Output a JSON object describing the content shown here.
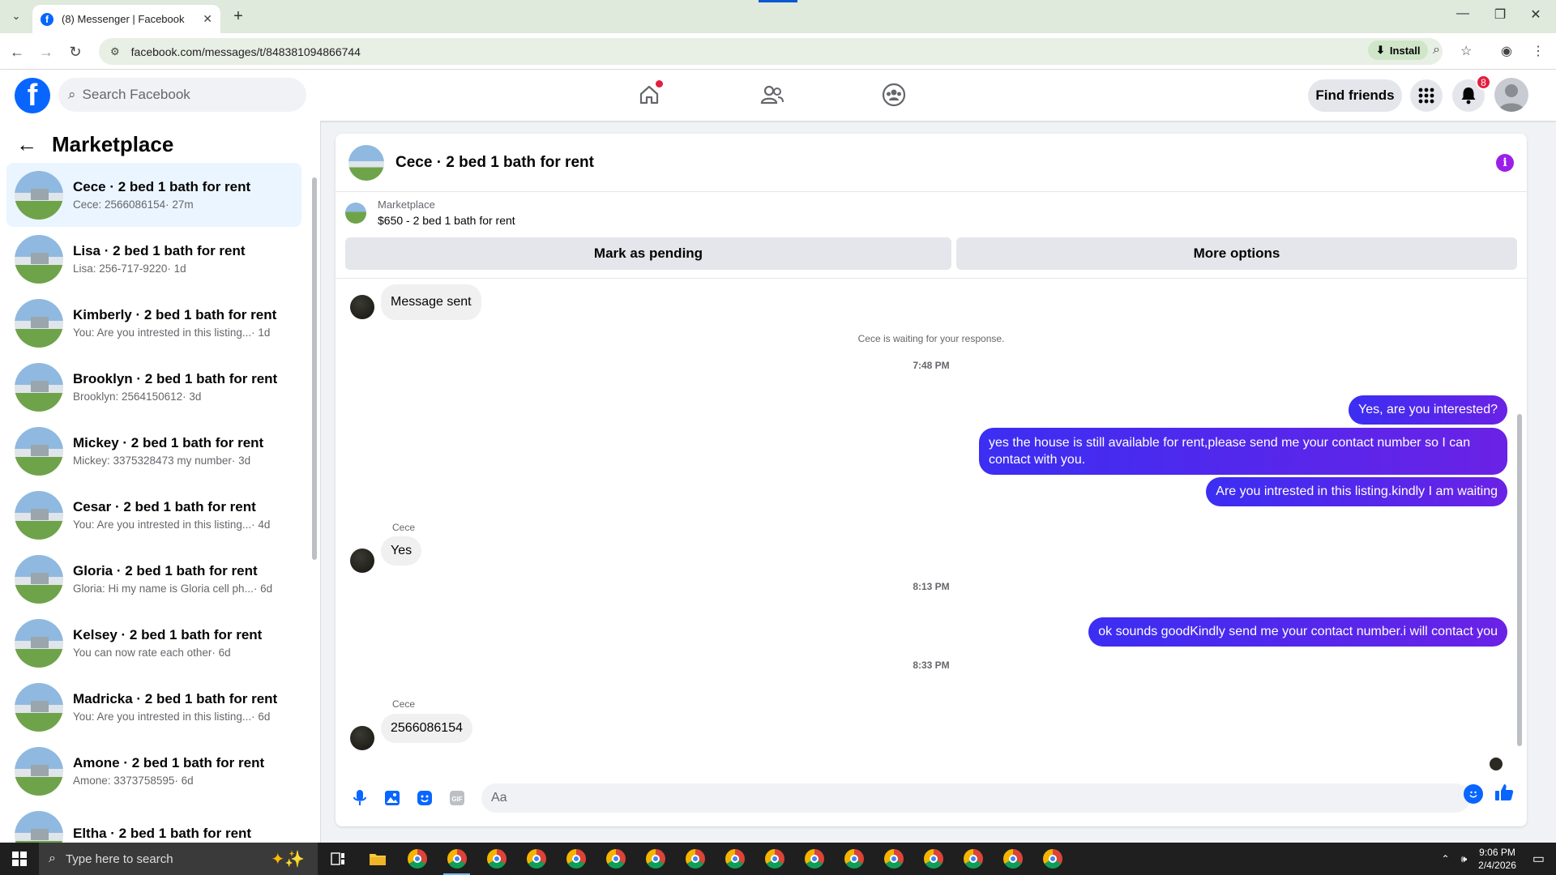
{
  "browser": {
    "tab_title": "(8) Messenger | Facebook",
    "url": "facebook.com/messages/t/848381094866744",
    "install_label": "Install"
  },
  "fb": {
    "search_placeholder": "Search Facebook",
    "find_friends_label": "Find friends",
    "notification_count": "8"
  },
  "sidebar": {
    "title": "Marketplace",
    "conversations": [
      {
        "name": "Cece · 2 bed 1 bath for rent",
        "preview": "Cece: 2566086154",
        "time": "· 27m",
        "active": true
      },
      {
        "name": "Lisa · 2 bed 1 bath for rent",
        "preview": "Lisa: 256-717-9220",
        "time": "· 1d"
      },
      {
        "name": "Kimberly · 2 bed 1 bath for rent",
        "preview": "You: Are you intrested in this listing...",
        "time": "· 1d"
      },
      {
        "name": "Brooklyn · 2 bed 1 bath for rent",
        "preview": "Brooklyn: 2564150612",
        "time": "· 3d"
      },
      {
        "name": "Mickey · 2 bed 1 bath for rent",
        "preview": "Mickey: 3375328473 my number",
        "time": "· 3d"
      },
      {
        "name": "Cesar · 2 bed 1 bath for rent",
        "preview": "You: Are you intrested in this listing...",
        "time": "· 4d"
      },
      {
        "name": "Gloria · 2 bed 1 bath for rent",
        "preview": "Gloria: Hi my name is Gloria cell ph...",
        "time": "· 6d"
      },
      {
        "name": "Kelsey · 2 bed 1 bath for rent",
        "preview": "You can now rate each other",
        "time": "· 6d"
      },
      {
        "name": "Madricka · 2 bed 1 bath for rent",
        "preview": "You: Are you intrested in this listing...",
        "time": "· 6d"
      },
      {
        "name": "Amone · 2 bed 1 bath for rent",
        "preview": "Amone: 3373758595",
        "time": "· 6d"
      },
      {
        "name": "Eltha · 2 bed 1 bath for rent",
        "preview": "",
        "time": ""
      }
    ]
  },
  "chat": {
    "title": "Cece · 2 bed 1 bath for rent",
    "listing_source": "Marketplace",
    "listing_title": "$650 - 2 bed 1 bath for rent",
    "mark_pending_label": "Mark as pending",
    "more_options_label": "More options",
    "msg_sent": "Message sent",
    "waiting_notice": "Cece is waiting for your response.",
    "time1": "7:48 PM",
    "out1": "Yes, are you interested?",
    "out2": "yes the house is still available for rent,please send me your contact number so I can contact with you.",
    "out3": "Are you intrested in this listing.kindly I am waiting",
    "sender1": "Cece",
    "in1": "Yes",
    "time2": "8:13 PM",
    "out4": "ok sounds goodKindly send me your contact number.i will contact you",
    "time3": "8:33 PM",
    "sender2": "Cece",
    "in2": "2566086154",
    "composer_placeholder": "Aa"
  },
  "taskbar": {
    "search_placeholder": "Type here to search",
    "time": "9:06 PM",
    "date": "2/4/2026"
  }
}
